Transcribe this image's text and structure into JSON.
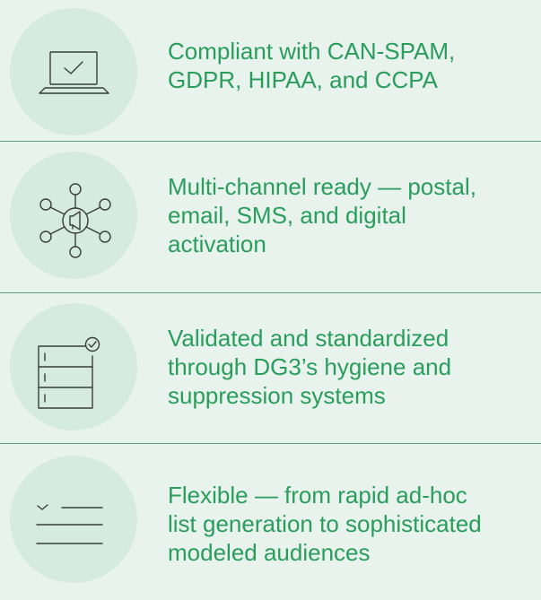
{
  "features": [
    {
      "icon": "laptop-check-icon",
      "lines": [
        "Compliant with CAN-SPAM,",
        "GDPR, HIPAA, and CCPA"
      ]
    },
    {
      "icon": "megaphone-network-icon",
      "lines": [
        "Multi-channel ready — postal,",
        "email, SMS, and digital",
        "activation"
      ]
    },
    {
      "icon": "server-check-icon",
      "lines": [
        "Validated and standardized",
        "through DG3’s hygiene and",
        "suppression systems"
      ]
    },
    {
      "icon": "checklist-icon",
      "lines": [
        "Flexible — from rapid ad-hoc",
        "list generation to sophisticated",
        "modeled audiences"
      ]
    }
  ],
  "colors": {
    "background": "#e8f3ee",
    "icon_circle": "#d5ebe0",
    "text": "#2a9d5c",
    "divider": "#5f9f7e",
    "icon_stroke": "#3a3d3c"
  }
}
